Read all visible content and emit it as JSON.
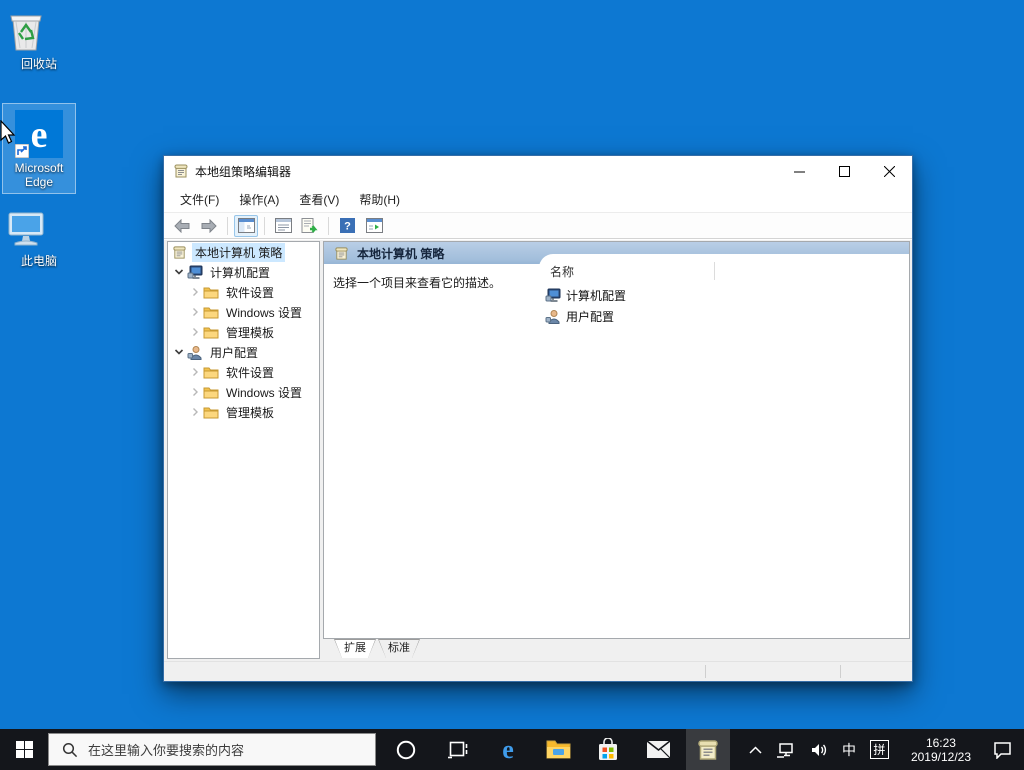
{
  "desktop": {
    "icons": [
      {
        "name": "recycle-bin",
        "label": "回收站"
      },
      {
        "name": "microsoft-edge",
        "label": "Microsoft Edge",
        "selected": true
      },
      {
        "name": "this-pc",
        "label": "此电脑"
      }
    ]
  },
  "window": {
    "title": "本地组策略编辑器",
    "menu": [
      {
        "label": "文件(F)"
      },
      {
        "label": "操作(A)"
      },
      {
        "label": "查看(V)"
      },
      {
        "label": "帮助(H)"
      }
    ],
    "toolbar": {
      "buttons": [
        "back",
        "forward",
        "show-console-tree",
        "properties",
        "export-list",
        "help",
        "show-action-pane"
      ],
      "active": "show-console-tree"
    },
    "tree": {
      "root": {
        "label": "本地计算机 策略",
        "selected": true
      },
      "items": [
        {
          "label": "计算机配置",
          "icon": "computer",
          "expanded": true
        },
        {
          "label": "软件设置",
          "icon": "folder",
          "collapsed": true
        },
        {
          "label": "Windows 设置",
          "icon": "folder",
          "collapsed": true
        },
        {
          "label": "管理模板",
          "icon": "folder",
          "collapsed": true
        },
        {
          "label": "用户配置",
          "icon": "user",
          "expanded": true
        },
        {
          "label": "软件设置",
          "icon": "folder",
          "collapsed": true
        },
        {
          "label": "Windows 设置",
          "icon": "folder",
          "collapsed": true
        },
        {
          "label": "管理模板",
          "icon": "folder",
          "collapsed": true
        }
      ]
    },
    "main": {
      "header": "本地计算机 策略",
      "description": "选择一个项目来查看它的描述。",
      "column_header": "名称",
      "items": [
        {
          "label": "计算机配置",
          "icon": "computer"
        },
        {
          "label": "用户配置",
          "icon": "user"
        }
      ],
      "tabs": [
        {
          "label": "扩展",
          "active": true
        },
        {
          "label": "标准",
          "active": false
        }
      ]
    }
  },
  "taskbar": {
    "search": {
      "placeholder": "在这里输入你要搜索的内容"
    },
    "apps": [
      "task-view",
      "edge",
      "file-explorer",
      "store",
      "mail",
      "gpedit"
    ],
    "active_app": "gpedit",
    "tray": {
      "ime_lang": "中",
      "ime_mode": "拼",
      "time": "16:23",
      "date": "2019/12/23"
    }
  },
  "colors": {
    "desktop_background": "#0d78d2",
    "taskbar_background": "#14161b",
    "accent": "#0078d7",
    "tree_selection": "#cce8ff",
    "mmc_header_top": "#b9cee6",
    "mmc_header_bottom": "#96b5d5"
  }
}
